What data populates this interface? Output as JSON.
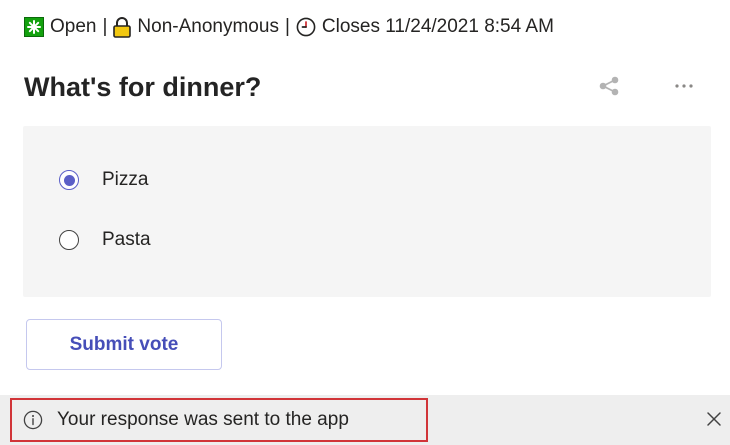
{
  "status": {
    "state_label": "Open",
    "privacy_label": "Non-Anonymous",
    "closes_label": "Closes 11/24/2021 8:54 AM",
    "separator": "|"
  },
  "poll": {
    "title": "What's for dinner?",
    "options": [
      {
        "label": "Pizza",
        "selected": true
      },
      {
        "label": "Pasta",
        "selected": false
      }
    ],
    "submit_label": "Submit vote"
  },
  "notification": {
    "message": "Your response was sent to the app"
  },
  "icons": {
    "status": "open-status-icon",
    "lock": "lock-icon",
    "clock": "clock-icon",
    "share": "share-icon",
    "more": "more-options-icon",
    "info": "info-icon",
    "close": "close-icon"
  },
  "colors": {
    "accent": "#5b5fc7",
    "button_text": "#464eb8",
    "button_border": "#c5c8ee",
    "card_bg": "#f5f5f5",
    "notice_bg": "#eeeeee",
    "highlight_border": "#d13438",
    "open_icon_bg": "#13a10e",
    "lock_color": "#f2c811"
  }
}
